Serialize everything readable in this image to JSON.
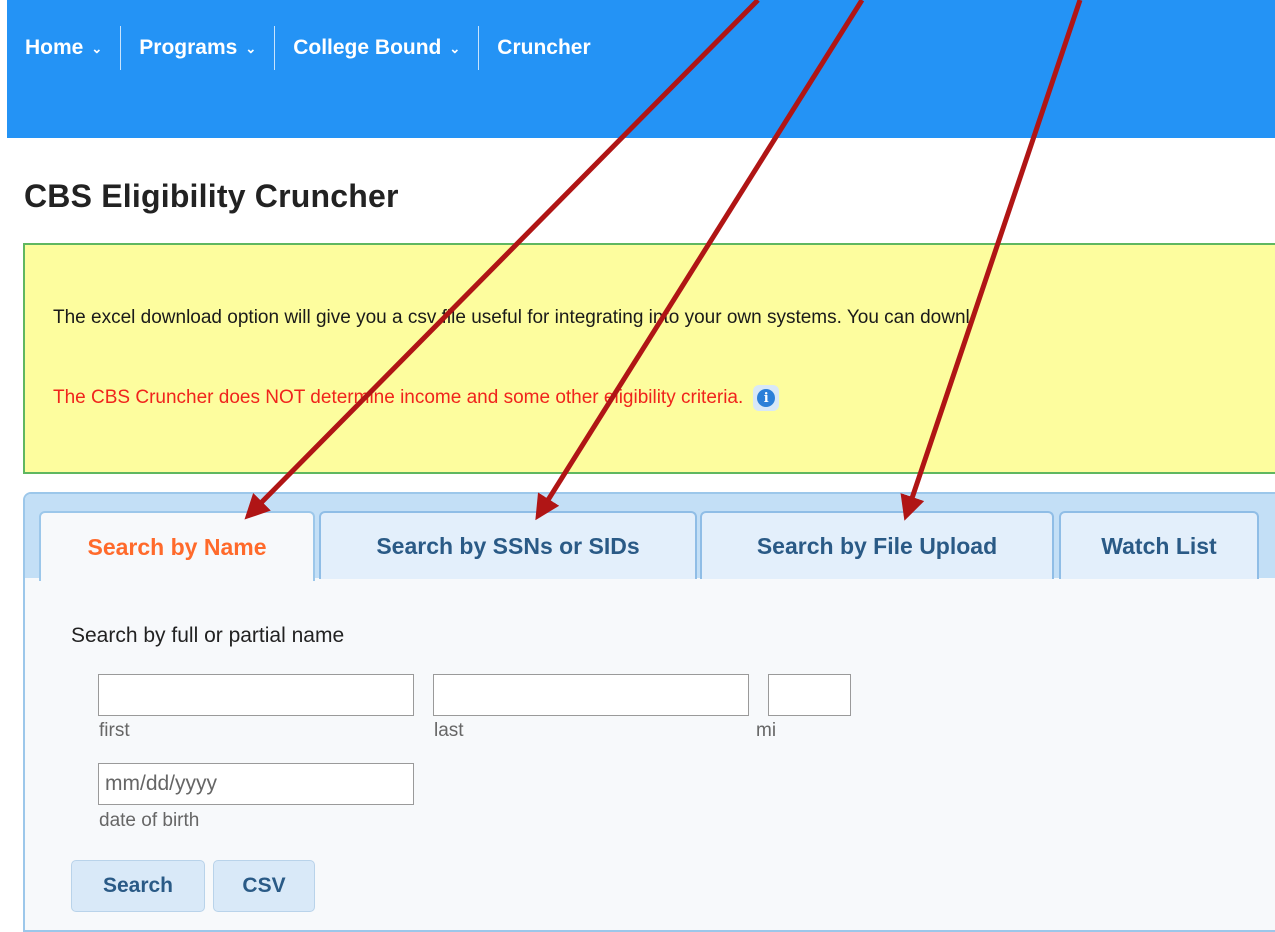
{
  "nav": {
    "items": [
      {
        "label": "Home",
        "dropdown": true
      },
      {
        "label": "Programs",
        "dropdown": true
      },
      {
        "label": "College Bound",
        "dropdown": true
      },
      {
        "label": "Cruncher",
        "dropdown": false
      }
    ]
  },
  "page_title": "CBS Eligibility Cruncher",
  "notice": {
    "line1": "The excel download option will give you a csv file useful for integrating into your own systems. You can downl",
    "line2": "The CBS Cruncher does NOT determine income and some other eligibility criteria.",
    "info_icon": "info-icon"
  },
  "tabs": [
    {
      "label": "Search by Name",
      "active": true
    },
    {
      "label": "Search by SSNs or SIDs",
      "active": false
    },
    {
      "label": "Search by File Upload",
      "active": false
    },
    {
      "label": "Watch List",
      "active": false
    }
  ],
  "form": {
    "heading": "Search by full or partial name",
    "first_caption": "first",
    "last_caption": "last",
    "mi_caption": "mi",
    "dob_placeholder": "mm/dd/yyyy",
    "dob_caption": "date of birth",
    "search_button": "Search",
    "csv_button": "CSV"
  },
  "colors": {
    "nav_bg": "#2493f5",
    "notice_bg": "#fdfd9e",
    "notice_warning": "#f0241c",
    "active_tab_text": "#ff6a2b",
    "annotation_arrow": "#b01515"
  }
}
